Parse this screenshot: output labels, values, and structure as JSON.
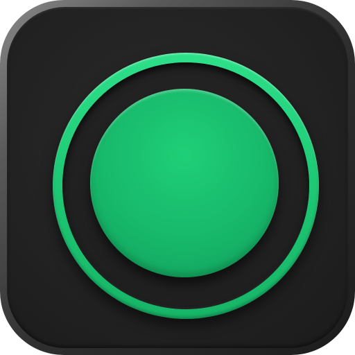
{
  "app_icon": {
    "icon": "record-button-icon",
    "colors": {
      "frame_light": "#8a8a8a",
      "face_dark": "#222222",
      "accent_green": "#1fca76",
      "accent_green_dark": "#119f5b"
    }
  }
}
